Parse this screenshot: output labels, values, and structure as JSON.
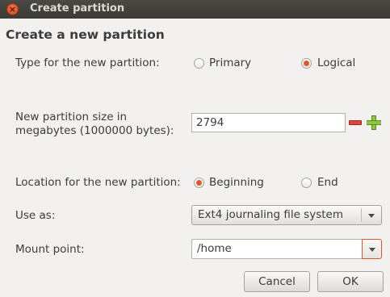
{
  "window": {
    "title": "Create partition",
    "close_icon": "close-icon"
  },
  "dialog": {
    "heading": "Create a new partition",
    "type_label": "Type for the new partition:",
    "type_options": [
      {
        "label": "Primary",
        "checked": false
      },
      {
        "label": "Logical",
        "checked": true
      }
    ],
    "size_label_line1": "New partition size in",
    "size_label_line2": "megabytes (1000000 bytes):",
    "size_value": "2794",
    "location_label": "Location for the new partition:",
    "location_options": [
      {
        "label": "Beginning",
        "checked": true
      },
      {
        "label": "End",
        "checked": false
      }
    ],
    "use_as_label": "Use as:",
    "use_as_value": "Ext4 journaling file system",
    "mount_label": "Mount point:",
    "mount_value": "/home",
    "cancel_label": "Cancel",
    "ok_label": "OK"
  },
  "colors": {
    "accent": "#e0582a",
    "titlebar": "#3c3b37",
    "background": "#f2f1f0"
  }
}
